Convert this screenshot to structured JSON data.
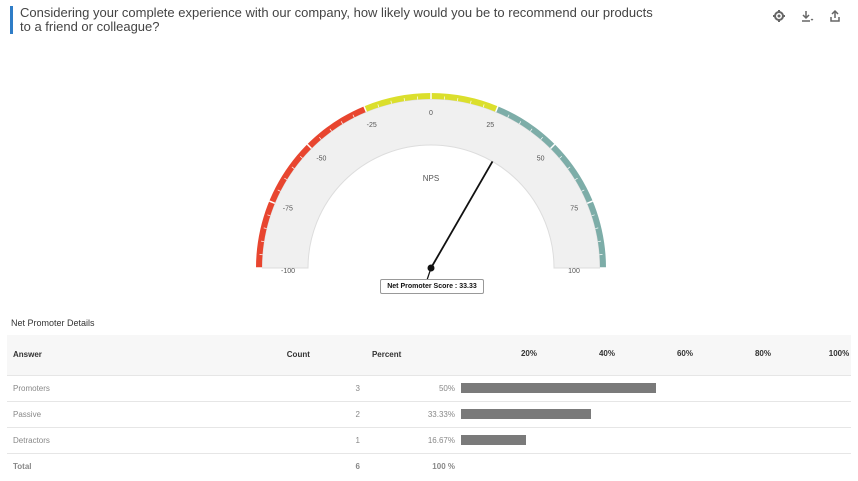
{
  "question": "Considering your complete experience with our company, how likely would you be to recommend our products to a friend or colleague?",
  "toolbar": {
    "icons": [
      "gear-icon",
      "download-icon",
      "share-icon"
    ]
  },
  "gauge": {
    "center_label": "NPS",
    "min": -100,
    "max": 100,
    "value": 33.33,
    "tick_labels": [
      "-100",
      "-75",
      "-50",
      "-25",
      "0",
      "25",
      "50",
      "75",
      "100"
    ],
    "tooltip_label": "Net Promoter Score :",
    "tooltip_value": "33.33",
    "band_colors": {
      "detractor": "#e8452f",
      "passive": "#dbdf2c",
      "promoter": "#7dada8"
    },
    "background_color": "#f0f0f0"
  },
  "details": {
    "title": "Net Promoter Details",
    "headers": {
      "answer": "Answer",
      "count": "Count",
      "percent": "Percent"
    },
    "percent_scale": [
      "20%",
      "40%",
      "60%",
      "80%",
      "100%"
    ],
    "rows": [
      {
        "answer": "Promoters",
        "count": "3",
        "percent": "50%",
        "fraction": 0.5
      },
      {
        "answer": "Passive",
        "count": "2",
        "percent": "33.33%",
        "fraction": 0.3333
      },
      {
        "answer": "Detractors",
        "count": "1",
        "percent": "16.67%",
        "fraction": 0.1667
      }
    ],
    "total": {
      "label": "Total",
      "count": "6",
      "percent": "100 %"
    }
  }
}
